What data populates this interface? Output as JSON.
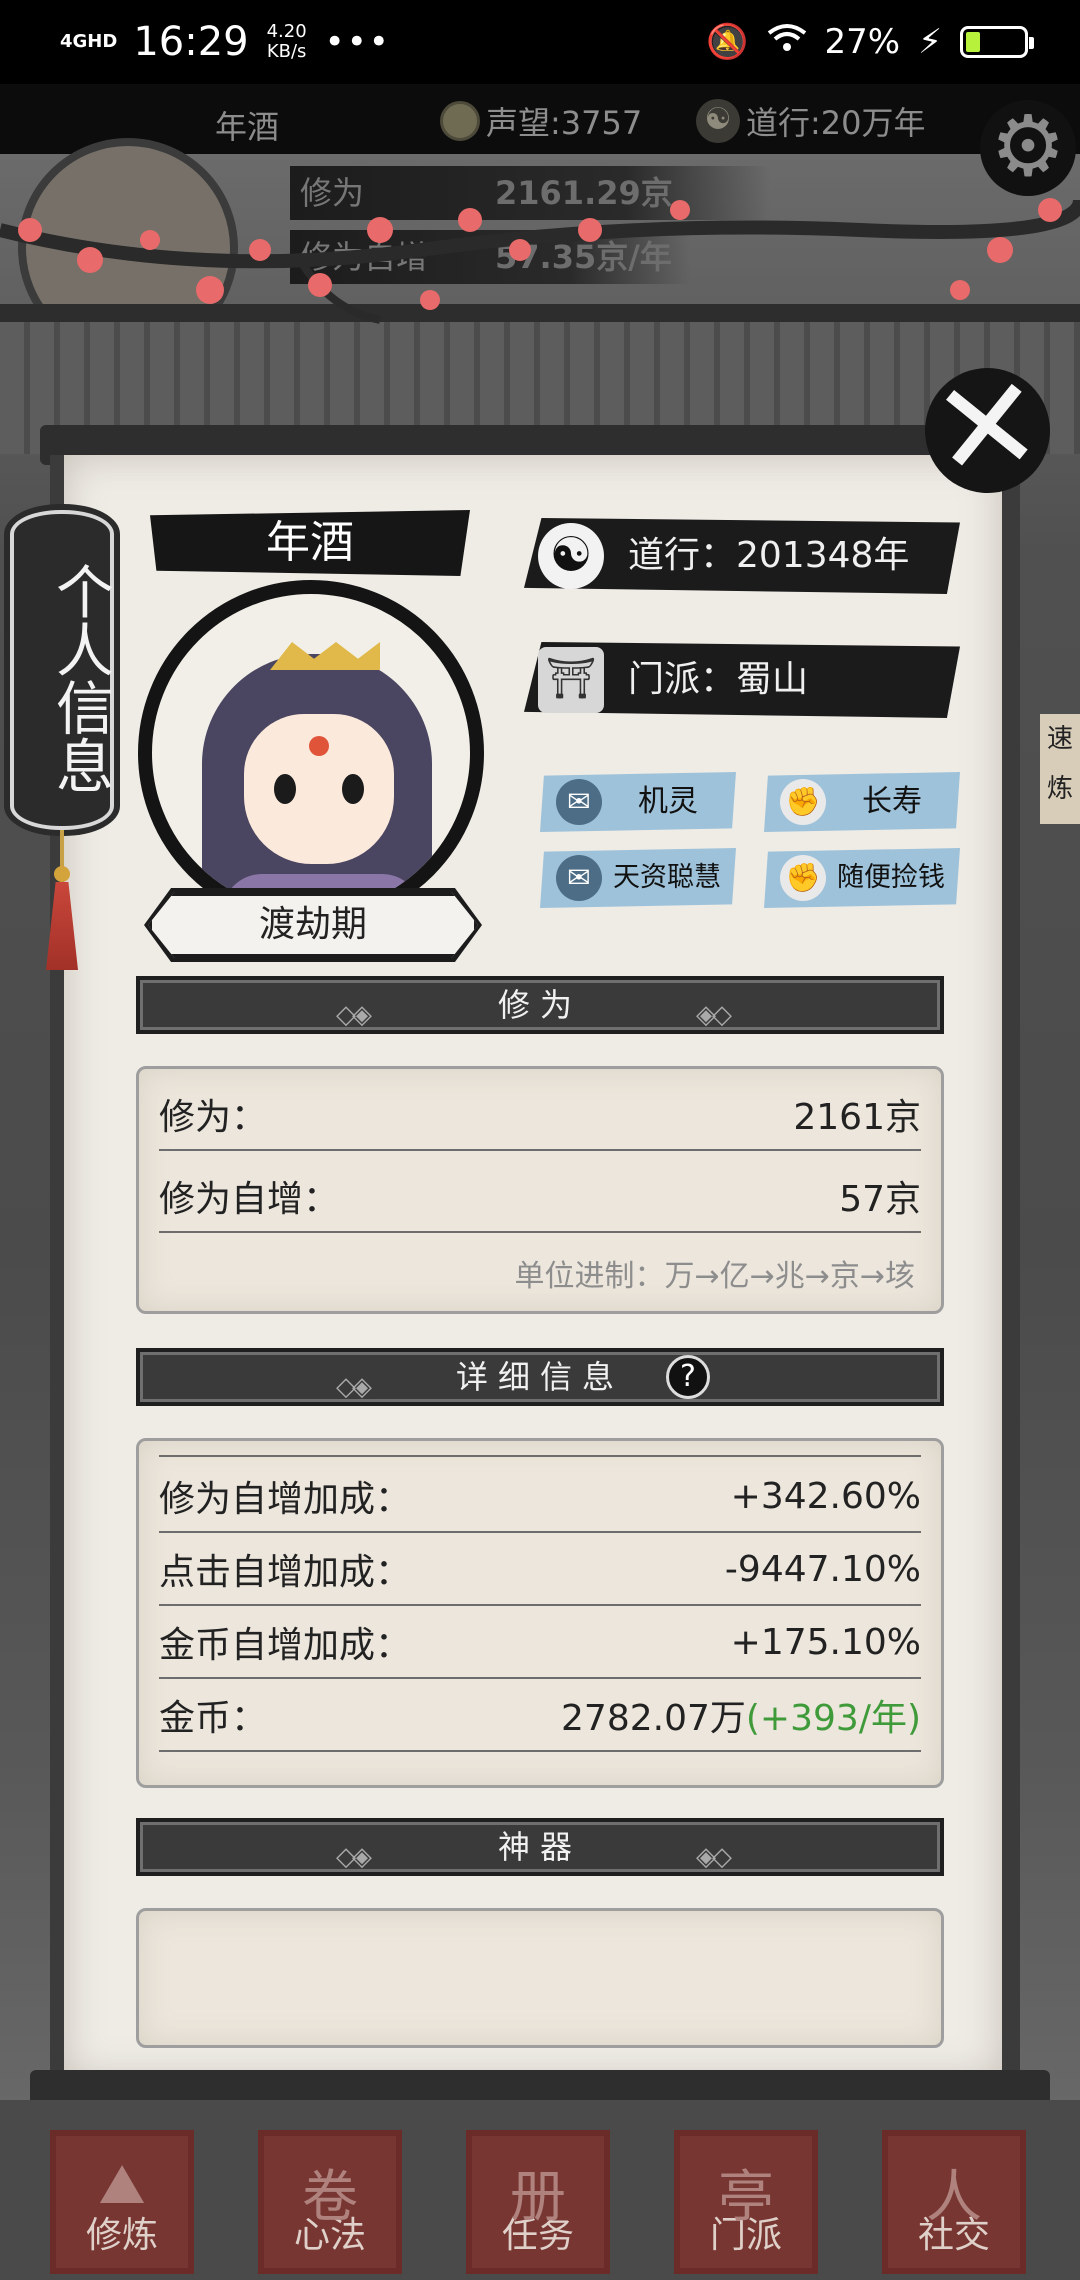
{
  "status_bar": {
    "network": "4GHD",
    "time": "16:29",
    "speed_value": "4.20",
    "speed_unit": "KB/s",
    "dots": "•••",
    "battery": "27%"
  },
  "hud": {
    "name": "年酒",
    "fame": "声望:3757",
    "dao": "道行:20万年",
    "cultivation_label": "修为",
    "cultivation_value": "2161.29京",
    "growth_label": "修为自增",
    "growth_value": "57.35京/年"
  },
  "panel": {
    "tab_label": "个人信息",
    "close_glyph": "✕",
    "profile": {
      "name": "年酒",
      "realm": "渡劫期",
      "dao_text": "道行：201348年",
      "sect_text": "门派：蜀山",
      "taiji_glyph": "☯",
      "gate_glyph": "⛩",
      "traits": [
        {
          "label": "机灵",
          "icon": "scroll-icon"
        },
        {
          "label": "长寿",
          "icon": "fist-icon"
        },
        {
          "label": "天资聪慧",
          "icon": "scroll-icon"
        },
        {
          "label": "随便捡钱",
          "icon": "fist-icon"
        }
      ]
    },
    "section_cultivation": {
      "title": "修为",
      "rows": [
        {
          "label": "修为：",
          "value": "2161京"
        },
        {
          "label": "修为自增：",
          "value": "57京"
        }
      ],
      "unit_note": "单位进制：万→亿→兆→京→垓"
    },
    "section_details": {
      "title": "详细信息",
      "help": "?",
      "rows": [
        {
          "label": "修为自增加成：",
          "value": "+342.60%"
        },
        {
          "label": "点击自增加成：",
          "value": "-9447.10%"
        },
        {
          "label": "金币自增加成：",
          "value": "+175.10%"
        }
      ],
      "gold_label": "金币：",
      "gold_value": "2782.07万",
      "gold_rate": "(+393/年)"
    },
    "section_artifact": {
      "title": "神器"
    }
  },
  "colors": {
    "trait_blue": "#9ec2da",
    "gold_rate_green": "#3f9a3a",
    "nav_red": "#7a3531"
  },
  "bottom_nav": [
    {
      "label": "修炼",
      "glyph": "⛰"
    },
    {
      "label": "心法",
      "glyph": "卷"
    },
    {
      "label": "任务",
      "glyph": "册"
    },
    {
      "label": "门派",
      "glyph": "亭"
    },
    {
      "label": "社交",
      "glyph": "人"
    }
  ],
  "side_right_text": "速炼"
}
